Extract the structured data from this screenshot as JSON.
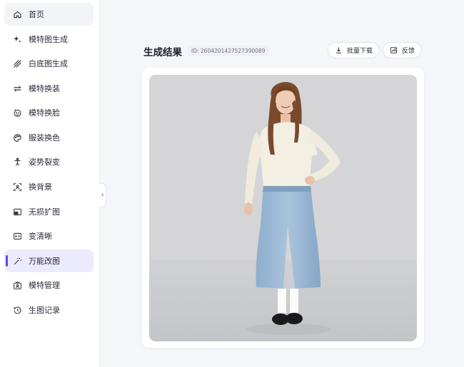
{
  "sidebar": {
    "items": [
      {
        "label": "首页",
        "icon": "home-icon"
      },
      {
        "label": "模特图生成",
        "icon": "sparkle-icon"
      },
      {
        "label": "白底图生成",
        "icon": "hatch-icon"
      },
      {
        "label": "模特换装",
        "icon": "swap-icon"
      },
      {
        "label": "模特换脸",
        "icon": "face-icon"
      },
      {
        "label": "服装换色",
        "icon": "palette-icon"
      },
      {
        "label": "姿势裂变",
        "icon": "person-pose-icon"
      },
      {
        "label": "换背景",
        "icon": "background-icon"
      },
      {
        "label": "无损扩图",
        "icon": "expand-image-icon"
      },
      {
        "label": "变清晰",
        "icon": "enhance-icon"
      },
      {
        "label": "万能改图",
        "icon": "magic-wand-icon"
      },
      {
        "label": "模特管理",
        "icon": "model-manage-icon"
      },
      {
        "label": "生图记录",
        "icon": "history-icon"
      }
    ],
    "active_index": 10,
    "collapse_icon": "chevron-right-icon"
  },
  "main": {
    "title": "生成结果",
    "id_text": "ID: 2604201427527390089",
    "buttons": {
      "batch_download": "批量下载",
      "feedback": "反馈"
    },
    "image_alt": "model wearing cream sweater and wide-leg denim"
  },
  "colors": {
    "accent": "#5b4ee0",
    "active_bg": "#eceafd",
    "page_bg": "#f5f6fa"
  }
}
